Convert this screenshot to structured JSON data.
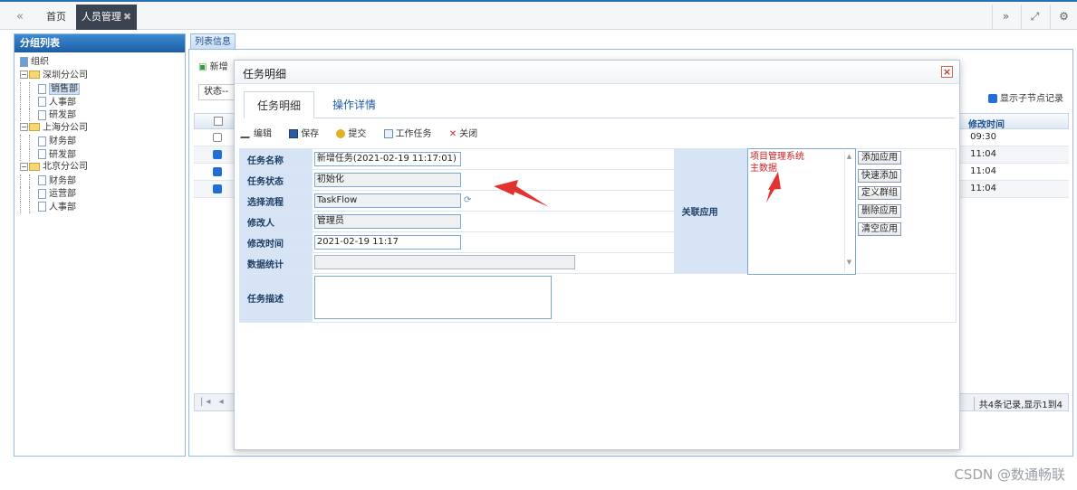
{
  "topbar": {
    "home_tab": "首页",
    "active_tab": "人员管理",
    "close_glyph": "✖"
  },
  "left_panel": {
    "title": "分组列表",
    "tree": {
      "root": "组织",
      "companies": [
        {
          "name": "深圳分公司",
          "departments": [
            "销售部",
            "人事部",
            "研发部"
          ]
        },
        {
          "name": "上海分公司",
          "departments": [
            "财务部",
            "研发部"
          ]
        },
        {
          "name": "北京分公司",
          "departments": [
            "财务部",
            "运营部",
            "人事部"
          ]
        }
      ],
      "selected": "销售部"
    }
  },
  "main": {
    "tab": "列表信息",
    "add_label": "新增",
    "status_label": "状态",
    "status_value": "--",
    "show_sub_label": "显示子节点记录",
    "grid": {
      "header_modified": "修改时间",
      "rows": [
        {
          "checked": false,
          "time": "09:30"
        },
        {
          "checked": true,
          "time": "11:04"
        },
        {
          "checked": true,
          "time": "11:04"
        },
        {
          "checked": true,
          "time": "11:04"
        }
      ]
    },
    "pager": {
      "info": "共4条记录,显示1到4"
    }
  },
  "dialog": {
    "title": "任务明细",
    "tabs": [
      "任务明细",
      "操作详情"
    ],
    "toolbar": {
      "edit": "编辑",
      "save": "保存",
      "submit": "提交",
      "work_task": "工作任务",
      "close": "关闭"
    },
    "fields": {
      "task_name_label": "任务名称",
      "task_name_value": "新增任务(2021-02-19 11:17:01)",
      "task_status_label": "任务状态",
      "task_status_value": "初始化",
      "flow_label": "选择流程",
      "flow_value": "TaskFlow",
      "modifier_label": "修改人",
      "modifier_value": "管理员",
      "modified_time_label": "修改时间",
      "modified_time_value": "2021-02-19 11:17",
      "data_stats_label": "数据统计",
      "data_stats_value": "",
      "description_label": "任务描述",
      "description_value": ""
    },
    "related": {
      "label": "关联应用",
      "items": [
        "项目管理系统",
        "主数据"
      ],
      "buttons": [
        "添加应用",
        "快速添加",
        "定义群组",
        "删除应用",
        "清空应用"
      ]
    }
  },
  "watermark": "CSDN @数通畅联",
  "colors": {
    "accent": "#1f5da3",
    "tab_active_bg": "#3b4350",
    "label_bg": "#d6e4f6",
    "annotation_red": "#e23232"
  }
}
